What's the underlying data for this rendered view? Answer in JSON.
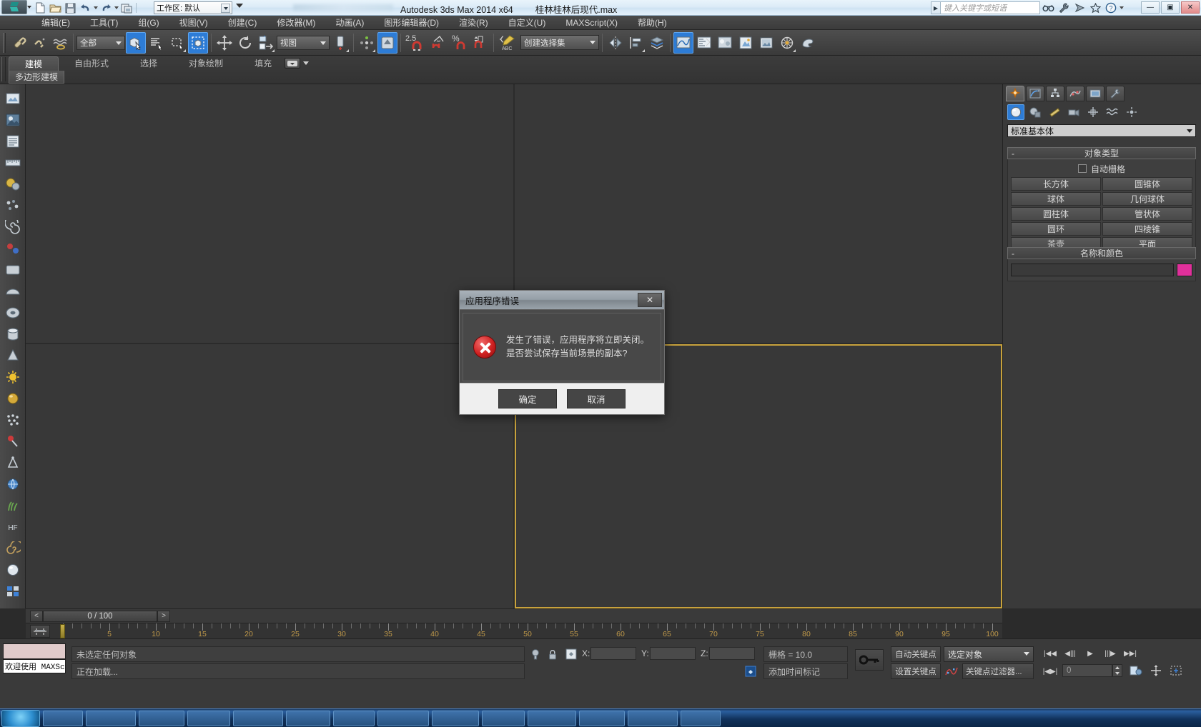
{
  "titlebar": {
    "app_title": "Autodesk 3ds Max  2014 x64",
    "file_name": "桂林桂林后现代.max",
    "workspace_label": "工作区: 默认",
    "search_placeholder": "键入关键字或短语",
    "quick_access": [
      {
        "name": "new-file",
        "label": "新建"
      },
      {
        "name": "open-file",
        "label": "打开"
      },
      {
        "name": "save-file",
        "label": "保存"
      },
      {
        "name": "undo",
        "label": "撤消"
      },
      {
        "name": "redo",
        "label": "重做"
      },
      {
        "name": "project-folder",
        "label": "项目文件夹"
      }
    ],
    "window_buttons": {
      "minimize": "—",
      "maximize": "▣",
      "close": "✕"
    },
    "infocenter_buttons": [
      "search-icon",
      "subscription-icon",
      "communication-icon",
      "favorites-icon",
      "help-icon"
    ]
  },
  "menubar": {
    "items": [
      {
        "label": "编辑(E)"
      },
      {
        "label": "工具(T)"
      },
      {
        "label": "组(G)"
      },
      {
        "label": "视图(V)"
      },
      {
        "label": "创建(C)"
      },
      {
        "label": "修改器(M)"
      },
      {
        "label": "动画(A)"
      },
      {
        "label": "图形编辑器(D)"
      },
      {
        "label": "渲染(R)"
      },
      {
        "label": "自定义(U)"
      },
      {
        "label": "MAXScript(X)"
      },
      {
        "label": "帮助(H)"
      }
    ]
  },
  "toolbar": {
    "selection_filter": "全部",
    "reference_coord": "视图",
    "named_selection_set": "创建选择集",
    "snap_percent_label": "2.5",
    "snap_percent_symbol": "%",
    "buttons": [
      {
        "name": "select-link-button",
        "title": "选择并链接"
      },
      {
        "name": "unlink-selection-button",
        "title": "断开当前选择链接"
      },
      {
        "name": "bind-space-warp-button",
        "title": "绑定到空间扭曲"
      },
      {
        "name": "select-object-button",
        "title": "选择对象",
        "active": true
      },
      {
        "name": "select-by-name-button",
        "title": "按名称选择"
      },
      {
        "name": "rectangular-selection-region-button",
        "title": "矩形选择区域"
      },
      {
        "name": "window-crossing-button",
        "title": "窗口/交叉",
        "active": true
      },
      {
        "name": "select-move-button",
        "title": "选择并移动"
      },
      {
        "name": "select-rotate-button",
        "title": "选择并旋转"
      },
      {
        "name": "select-scale-button",
        "title": "选择并缩放"
      },
      {
        "name": "mirror-button",
        "title": "镜像"
      },
      {
        "name": "align-button",
        "title": "对齐"
      },
      {
        "name": "snaps-toggle-button",
        "title": "捕捉开关",
        "active": true
      },
      {
        "name": "angle-snap-button",
        "title": "角度捕捉切换"
      },
      {
        "name": "percent-snap-button",
        "title": "百分比捕捉切换"
      },
      {
        "name": "spinner-snap-button",
        "title": "微调器捕捉切换"
      },
      {
        "name": "edit-named-selection-button",
        "title": "编辑命名选择集"
      },
      {
        "name": "layer-manager-button",
        "title": "层管理器"
      },
      {
        "name": "curve-editor-button",
        "title": "曲线编辑器"
      },
      {
        "name": "schematic-view-button",
        "title": "图解视图"
      },
      {
        "name": "material-editor-button",
        "title": "材质编辑器"
      },
      {
        "name": "render-setup-button",
        "title": "渲染设置"
      },
      {
        "name": "rendered-frame-window-button",
        "title": "渲染帧窗口"
      },
      {
        "name": "render-production-button",
        "title": "渲染产品"
      },
      {
        "name": "render-iterative-button",
        "title": "迭代渲染"
      },
      {
        "name": "activeshade-button",
        "title": "ActiveShade"
      }
    ]
  },
  "ribbon": {
    "tabs": [
      {
        "label": "建模",
        "active": true
      },
      {
        "label": "自由形式",
        "active": false
      },
      {
        "label": "选择",
        "active": false
      },
      {
        "label": "对象绘制",
        "active": false
      },
      {
        "label": "填充",
        "active": false
      }
    ],
    "subtab": "多边形建模"
  },
  "left_toolbar": {
    "buttons": [
      {
        "name": "asset-tracking-icon"
      },
      {
        "name": "render-preview-icon"
      },
      {
        "name": "list-view-icon"
      },
      {
        "name": "ruler-icon"
      },
      {
        "name": "material-sphere-icon"
      },
      {
        "name": "particle-icon"
      },
      {
        "name": "spiral-icon"
      },
      {
        "name": "helper-icon"
      },
      {
        "name": "box-shape-icon"
      },
      {
        "name": "hemisphere-icon"
      },
      {
        "name": "torus-icon"
      },
      {
        "name": "cylinder-icon"
      },
      {
        "name": "cone-icon"
      },
      {
        "name": "sun-light-icon"
      },
      {
        "name": "sphere-gold-icon"
      },
      {
        "name": "scatter-icon"
      },
      {
        "name": "pin-icon"
      },
      {
        "name": "compass-icon"
      },
      {
        "name": "globe-icon"
      },
      {
        "name": "grass-icon"
      },
      {
        "name": "hf-icon"
      },
      {
        "name": "swirl-icon"
      },
      {
        "name": "sphere-white-icon"
      },
      {
        "name": "blocks-icon"
      }
    ]
  },
  "command_panel": {
    "tabs": [
      {
        "name": "create-tab",
        "active": true
      },
      {
        "name": "modify-tab",
        "active": false
      },
      {
        "name": "hierarchy-tab",
        "active": false
      },
      {
        "name": "motion-tab",
        "active": false
      },
      {
        "name": "display-tab",
        "active": false
      },
      {
        "name": "utilities-tab",
        "active": false
      }
    ],
    "category_buttons": [
      {
        "name": "geometry-button",
        "active": true
      },
      {
        "name": "shapes-button",
        "active": false
      },
      {
        "name": "lights-button",
        "active": false
      },
      {
        "name": "cameras-button",
        "active": false
      },
      {
        "name": "helpers-button",
        "active": false
      },
      {
        "name": "space-warps-button",
        "active": false
      },
      {
        "name": "systems-button",
        "active": false
      }
    ],
    "subcategory": "标准基本体",
    "object_type_rollout": {
      "title": "对象类型",
      "autogrid_label": "自动栅格",
      "autogrid_checked": false,
      "buttons": [
        "长方体",
        "圆锥体",
        "球体",
        "几何球体",
        "圆柱体",
        "管状体",
        "圆环",
        "四棱锥",
        "茶壶",
        "平面"
      ]
    },
    "name_color_rollout": {
      "title": "名称和颜色",
      "name_value": "",
      "color": "#e0309b"
    }
  },
  "time_slider": {
    "current_frame_label": "0 / 100",
    "prev_label": "<",
    "next_label": ">"
  },
  "track_bar": {
    "tick_labels": [
      "5",
      "10",
      "15",
      "20",
      "25",
      "30",
      "35",
      "40",
      "45",
      "50",
      "55",
      "60",
      "65",
      "70",
      "75",
      "80",
      "85",
      "90",
      "95",
      "100"
    ]
  },
  "status_bar": {
    "maxscript_mini_listener": "欢迎使用 MAXScr",
    "selection_status": "未选定任何对象",
    "prompt_line": "正在加载...",
    "coord_labels": {
      "x": "X:",
      "y": "Y:",
      "z": "Z:"
    },
    "coord_values": {
      "x": "",
      "y": "",
      "z": ""
    },
    "grid_label": "栅格 = 10.0",
    "add_time_tag": "添加时间标记",
    "auto_key": "自动关键点",
    "set_key": "设置关键点",
    "key_mode_selection": "选定对象",
    "key_filters": "关键点过滤器...",
    "frame_field": "0",
    "lock_selection_icon": "lock-icon",
    "isolate_selection_icon": "isolate-icon",
    "key_icon": "key-icon",
    "playback_buttons": [
      {
        "name": "go-to-start-button",
        "glyph": "|◀◀"
      },
      {
        "name": "previous-frame-button",
        "glyph": "◀|||"
      },
      {
        "name": "play-animation-button",
        "glyph": "▶"
      },
      {
        "name": "next-frame-button",
        "glyph": "|||▶"
      },
      {
        "name": "go-to-end-button",
        "glyph": "▶▶|"
      },
      {
        "name": "key-mode-toggle-button",
        "glyph": "|◀▶|"
      }
    ]
  },
  "dialog": {
    "title": "应用程序错误",
    "close_glyph": "✕",
    "message_line1": "发生了错误，应用程序将立即关闭。",
    "message_line2": "是否尝试保存当前场景的副本?",
    "ok_label": "确定",
    "cancel_label": "取消",
    "icon": "error-icon"
  }
}
